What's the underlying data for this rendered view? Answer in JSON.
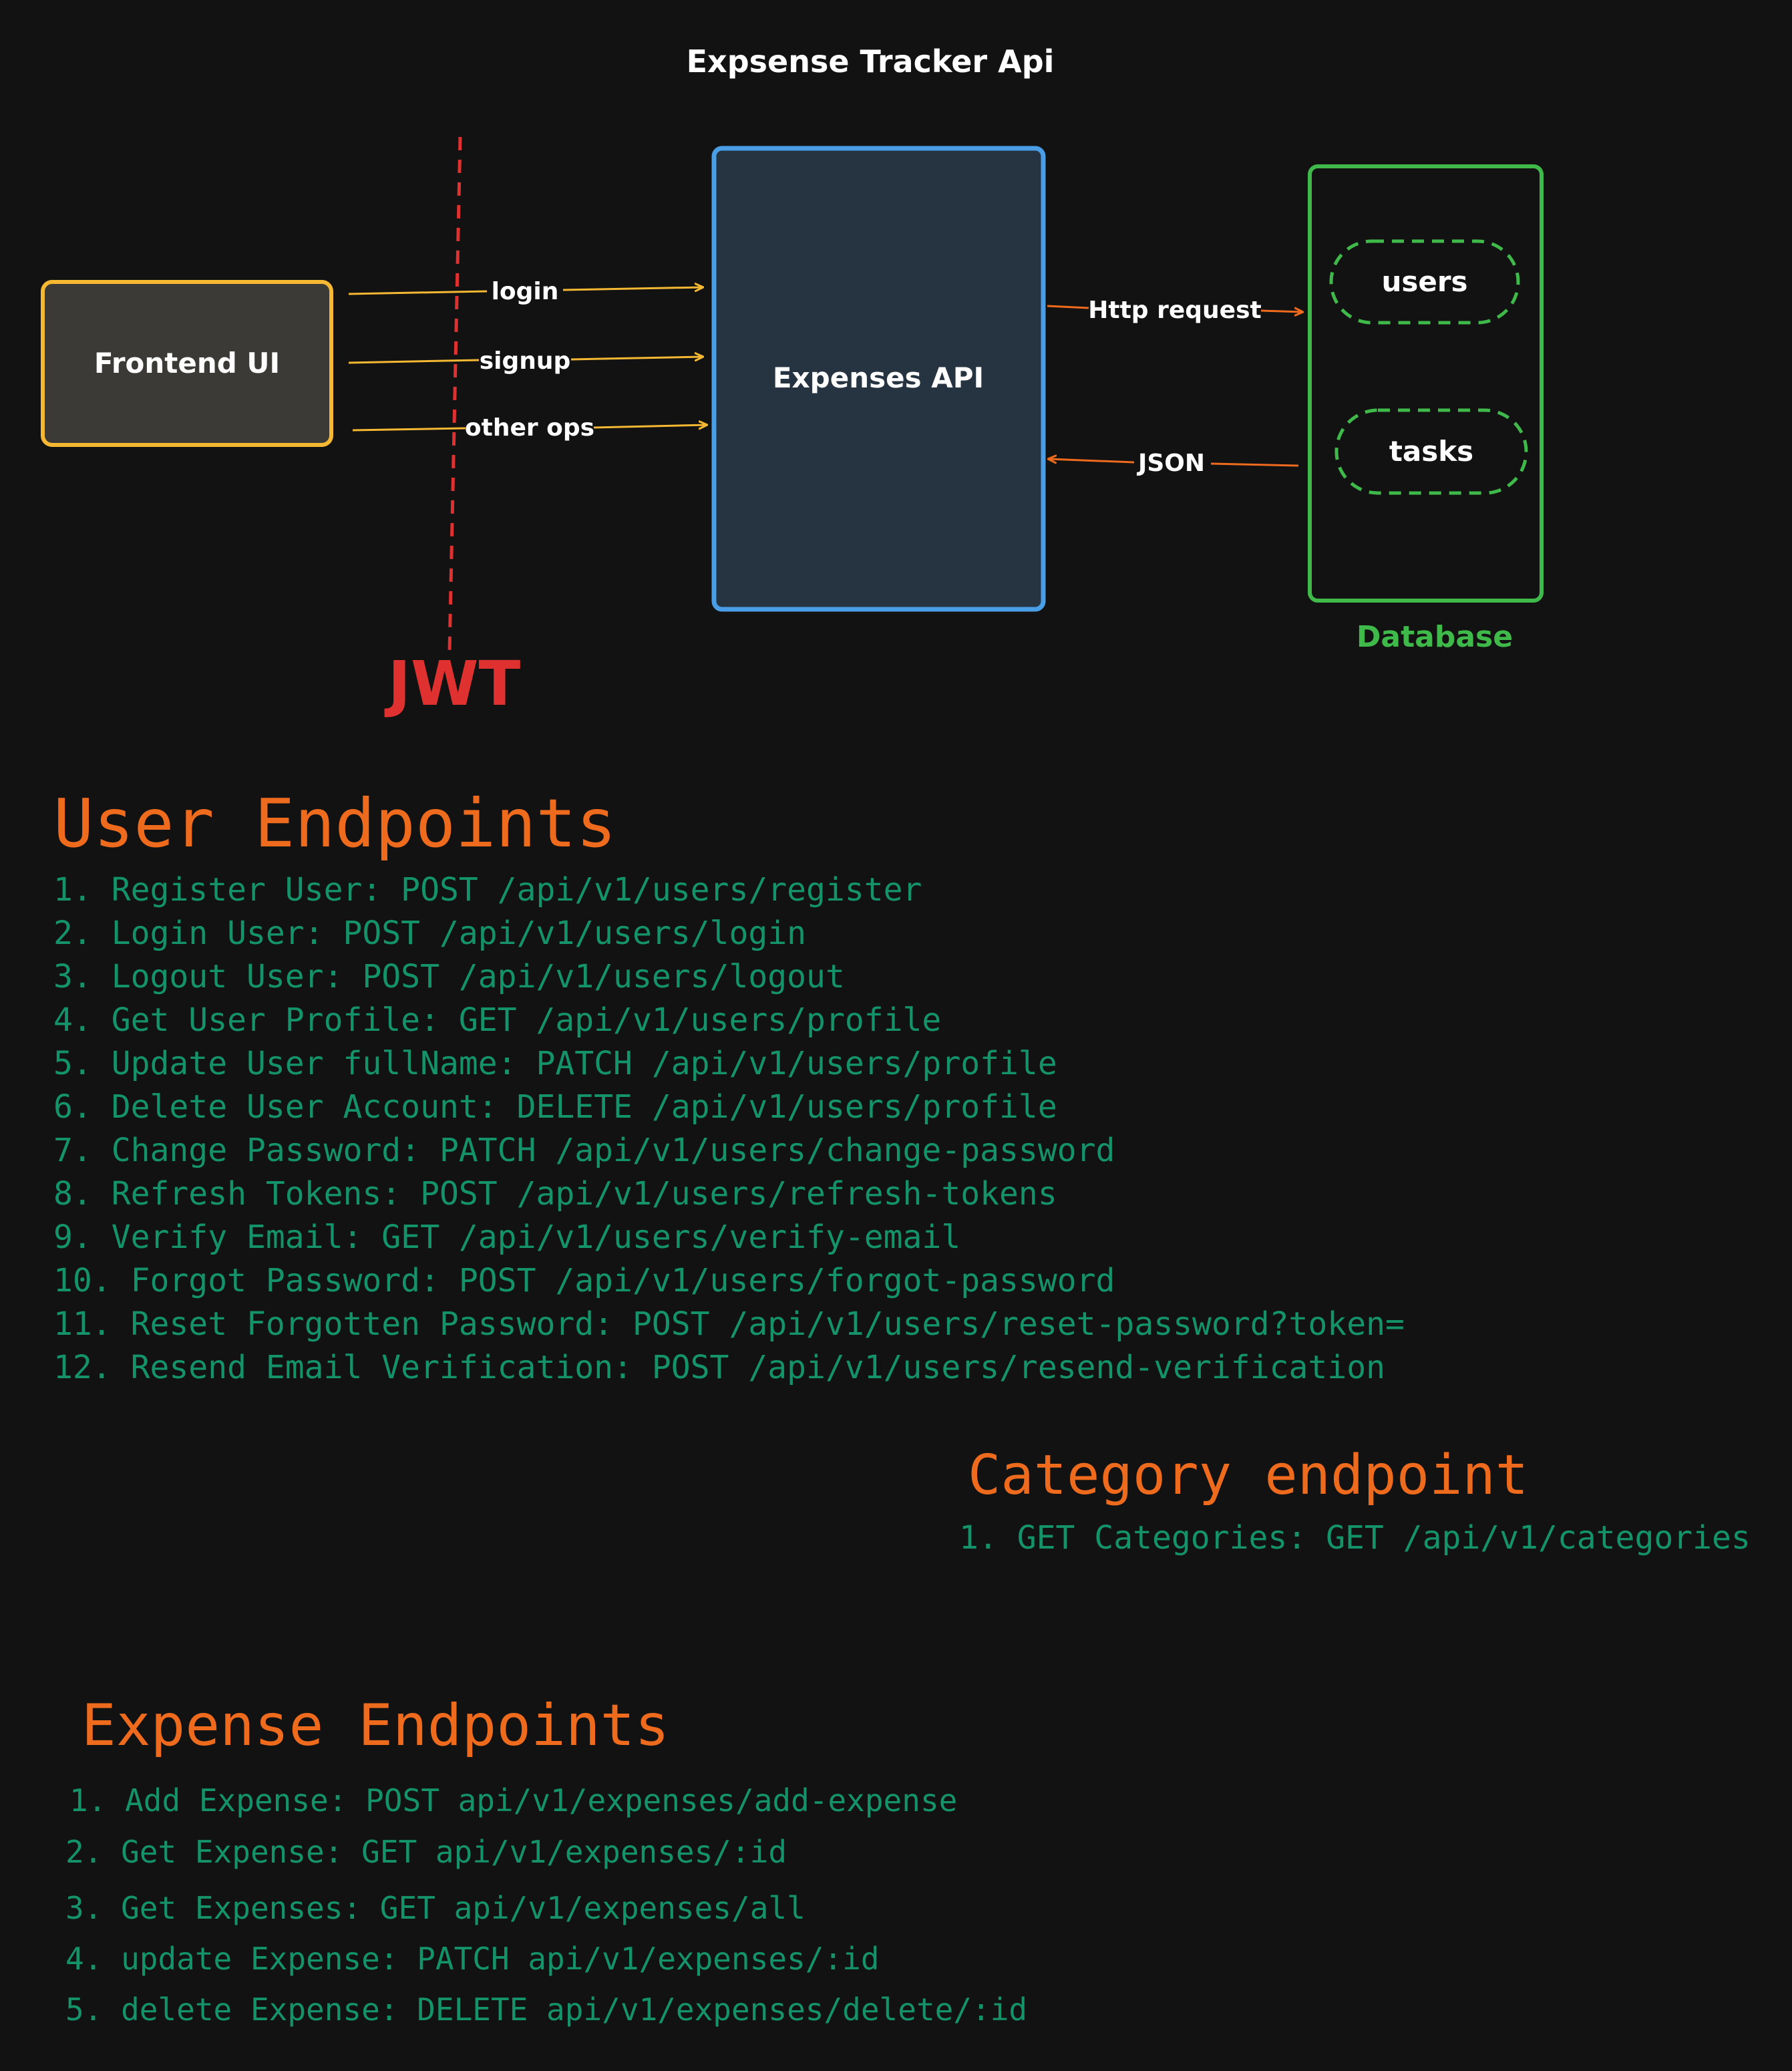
{
  "diagram": {
    "title": "Expsense Tracker Api",
    "frontend_label": "Frontend UI",
    "api_label": "Expenses API",
    "db_label": "Database",
    "db_tables": [
      "users",
      "tasks"
    ],
    "jwt_label": "JWT",
    "edges": {
      "login": "login",
      "signup": "signup",
      "other_ops": "other ops",
      "http_request": "Http request",
      "json": "JSON"
    },
    "colors": {
      "frontend": "#f5b833",
      "api": "#4a9ee6",
      "database": "#3fb94a",
      "jwt": "#e03131",
      "arrow_left": "#f5b833",
      "arrow_right": "#ee6b1e"
    }
  },
  "user_section": {
    "title": "User Endpoints",
    "items": [
      "1. Register User: POST /api/v1/users/register",
      "2. Login User: POST /api/v1/users/login",
      "3. Logout User: POST /api/v1/users/logout",
      "4. Get User Profile: GET /api/v1/users/profile",
      "5. Update User fullName: PATCH /api/v1/users/profile",
      "6. Delete User Account: DELETE /api/v1/users/profile",
      "7. Change Password: PATCH /api/v1/users/change-password",
      "8. Refresh Tokens: POST /api/v1/users/refresh-tokens",
      "9. Verify Email: GET /api/v1/users/verify-email",
      "10. Forgot Password: POST /api/v1/users/forgot-password",
      "11. Reset Forgotten Password: POST /api/v1/users/reset-password?token=",
      "12. Resend Email Verification: POST /api/v1/users/resend-verification"
    ]
  },
  "category_section": {
    "title": "Category endpoint",
    "items": [
      "1. GET Categories: GET /api/v1/categories"
    ]
  },
  "expense_section": {
    "title": "Expense Endpoints",
    "items": [
      "1. Add Expense: POST api/v1/expenses/add-expense",
      "2. Get Expense: GET api/v1/expenses/:id",
      "3. Get Expenses: GET api/v1/expenses/all",
      "4. update Expense: PATCH api/v1/expenses/:id",
      "5. delete Expense: DELETE api/v1/expenses/delete/:id"
    ]
  }
}
